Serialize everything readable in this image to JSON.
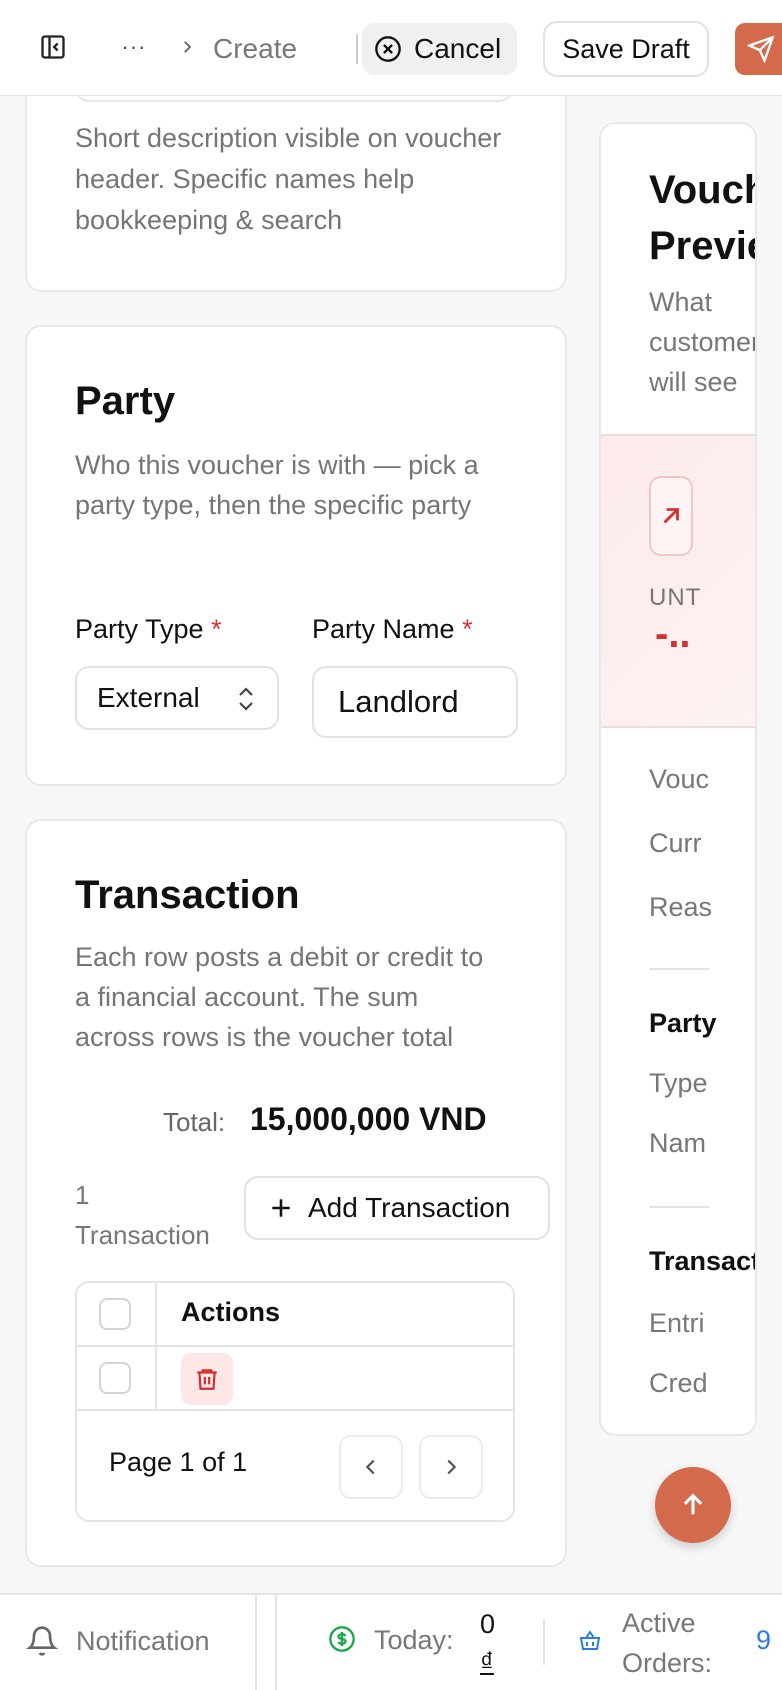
{
  "header": {
    "breadcrumb_more": "···",
    "breadcrumb_current": "Create",
    "cancel_label": "Cancel",
    "save_draft_label": "Save Draft"
  },
  "reason_card": {
    "description": "Short description visible on voucher header. Specific names help bookkeeping & search"
  },
  "party_card": {
    "title": "Party",
    "description": "Who this voucher is with — pick a party type, then the specific party",
    "party_type_label": "Party Type",
    "party_type_value": "External",
    "party_name_label": "Party Name",
    "party_name_value": "Landlord",
    "required_mark": "*"
  },
  "transaction_card": {
    "title": "Transaction",
    "description": "Each row posts a debit or credit to a financial account. The sum across rows is the voucher total",
    "total_label": "Total:",
    "total_value": "15,000,000 VND",
    "count_number": "1",
    "count_label": "Transaction",
    "add_label": "Add Transaction",
    "table": {
      "header_actions": "Actions",
      "row_count": 1
    },
    "pagination": "Page 1 of 1"
  },
  "preview": {
    "title_line1": "Vouche",
    "title_line2": "Preview",
    "subtitle_line1": "What",
    "subtitle_line2": "customers",
    "subtitle_line3": "will see",
    "amount_label": "UNT",
    "amount_value": "-..",
    "rows": [
      "Vouc",
      "Curr",
      "Reas"
    ],
    "party_heading": "Party",
    "party_rows": [
      "Type",
      "Nam"
    ],
    "transaction_heading": "Transactio",
    "transaction_rows": [
      "Entri",
      "Cred"
    ],
    "accent_color": "#d32f2f"
  },
  "bottom_bar": {
    "notification_label": "Notification",
    "today_label": "Today:",
    "today_value_line1": "0",
    "today_value_line2": "₫",
    "active_orders_line1": "Active",
    "active_orders_line2": "Orders:",
    "active_orders_value": "9"
  }
}
